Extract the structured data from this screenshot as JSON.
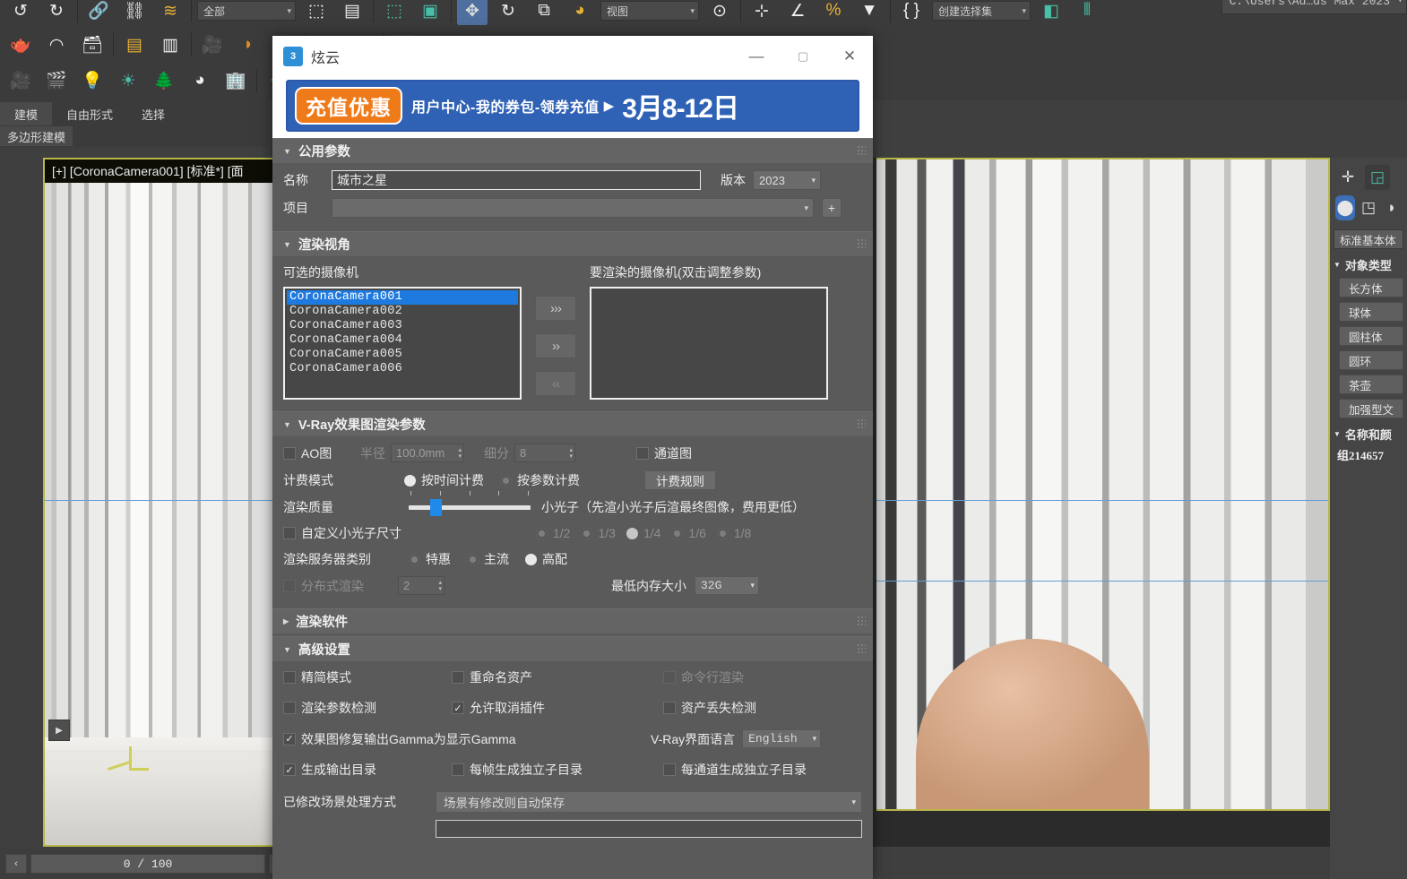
{
  "max": {
    "toolbar_combo": "全部",
    "toolbar_combo2": "创建选择集",
    "path_field": "C:\\Users\\Ad…ds Max 2023",
    "ribbon_tabs": [
      {
        "label": "建模",
        "active": true
      },
      {
        "label": "自由形式",
        "active": false
      },
      {
        "label": "选择",
        "active": false
      }
    ],
    "ribbon_sub": "多边形建模",
    "viewport_label": "[+] [CoronaCamera001] [标准*] [面",
    "timeline": {
      "prev": "‹",
      "value": "0 / 100",
      "next": "›"
    },
    "vp_nav": "▶"
  },
  "command_panel": {
    "tab_icons": [
      "create-icon",
      "modify-icon"
    ],
    "category_icons": [
      "geometry-icon",
      "shapes-icon",
      "lights-icon"
    ],
    "subcategory": "标准基本体",
    "object_type_header": "对象类型",
    "object_buttons": [
      "长方体",
      "球体",
      "圆柱体",
      "圆环",
      "茶壶",
      "加强型文"
    ],
    "name_color_header": "名称和颜",
    "object_name": "组214657"
  },
  "dialog": {
    "title": "炫云",
    "logo_text": "3",
    "controls": {
      "minimize": "—",
      "maximize": "▢",
      "close": "✕"
    },
    "banner": {
      "badge": "充值优惠",
      "text": "用户中心-我的券包-领券充值",
      "play": "▶",
      "date": "3月8-12日"
    },
    "sections": {
      "common": {
        "title": "公用参数",
        "name_label": "名称",
        "name_value": "城市之星",
        "version_label": "版本",
        "version_value": "2023",
        "project_label": "项目",
        "project_value": "",
        "add_button": "+"
      },
      "render_view": {
        "title": "渲染视角",
        "available_label": "可选的摄像机",
        "target_label": "要渲染的摄像机(双击调整参数)",
        "cameras": [
          "CoronaCamera001",
          "CoronaCamera002",
          "CoronaCamera003",
          "CoronaCamera004",
          "CoronaCamera005",
          "CoronaCamera006"
        ],
        "selected_index": 0,
        "target_cameras": [],
        "btn_add_all": "›››",
        "btn_add": "››",
        "btn_remove": "‹‹"
      },
      "vray": {
        "title": "V-Ray效果图渲染参数",
        "ao_label": "AO图",
        "ao_checked": false,
        "radius_label": "半径",
        "radius_value": "100.0mm",
        "subdiv_label": "细分",
        "subdiv_value": "8",
        "channel_label": "通道图",
        "channel_checked": false,
        "billing_label": "计费模式",
        "billing_options": [
          {
            "label": "按时间计费",
            "selected": true
          },
          {
            "label": "按参数计费",
            "selected": false
          }
        ],
        "billing_rule_button": "计费规则",
        "quality_label": "渲染质量",
        "quality_note": "小光子（先渲小光子后渲最终图像，费用更低）",
        "quality_value": 1,
        "custom_photon_label": "自定义小光子尺寸",
        "custom_photon_checked": false,
        "photon_sizes": [
          {
            "label": "1/2",
            "selected": false
          },
          {
            "label": "1/3",
            "selected": false
          },
          {
            "label": "1/4",
            "selected": true
          },
          {
            "label": "1/6",
            "selected": false
          },
          {
            "label": "1/8",
            "selected": false
          }
        ],
        "server_label": "渲染服务器类别",
        "server_options": [
          {
            "label": "特惠",
            "selected": false
          },
          {
            "label": "主流",
            "selected": false
          },
          {
            "label": "高配",
            "selected": true
          }
        ],
        "distributed_label": "分布式渲染",
        "distributed_checked": false,
        "distributed_count": "2",
        "memory_label": "最低内存大小",
        "memory_value": "32G"
      },
      "render_software": {
        "title": "渲染软件"
      },
      "advanced": {
        "title": "高级设置",
        "rows": [
          [
            {
              "label": "精简模式",
              "checked": false,
              "disabled": false
            },
            {
              "label": "重命名资产",
              "checked": false,
              "disabled": false
            },
            {
              "label": "命令行渲染",
              "checked": false,
              "disabled": true
            }
          ],
          [
            {
              "label": "渲染参数检测",
              "checked": false,
              "disabled": false
            },
            {
              "label": "允许取消插件",
              "checked": true,
              "disabled": false
            },
            {
              "label": "资产丢失检测",
              "checked": false,
              "disabled": false
            }
          ]
        ],
        "gamma_label": "效果图修复输出Gamma为显示Gamma",
        "gamma_checked": true,
        "vray_lang_label": "V-Ray界面语言",
        "vray_lang_value": "English",
        "outdir_label": "生成输出目录",
        "outdir_checked": true,
        "perframe_label": "每帧生成独立子目录",
        "perframe_checked": false,
        "perchannel_label": "每通道生成独立子目录",
        "perchannel_checked": false,
        "modified_scene_label": "已修改场景处理方式",
        "modified_scene_value": "场景有修改则自动保存"
      }
    }
  }
}
